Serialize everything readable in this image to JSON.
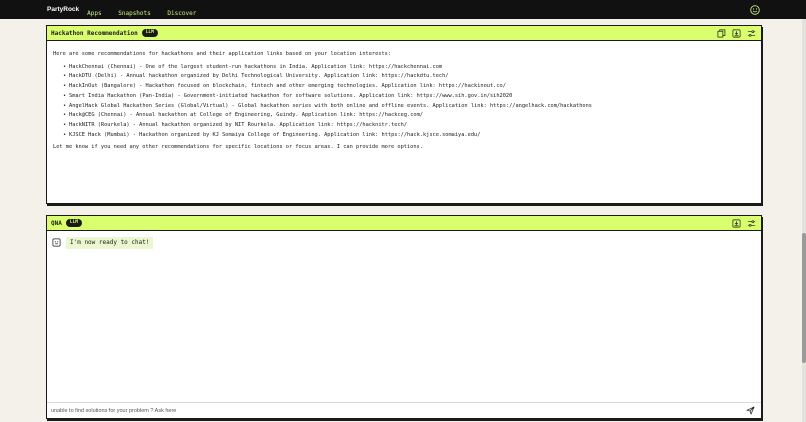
{
  "topbar": {
    "brand": "PartyRock",
    "nav": [
      "Apps",
      "Snapshots",
      "Discover"
    ],
    "profile_icon": "smiley-icon"
  },
  "colors": {
    "accent": "#d9ff6e",
    "topbar_bg": "#111111",
    "nav_link": "#c7f284",
    "page_bg": "#f3f1ea"
  },
  "panel1": {
    "title": "Hackathon Recommendation",
    "badge": "LLM",
    "icons": [
      "copy-icon",
      "save-icon",
      "settings-sliders-icon"
    ],
    "intro": "Here are some recommendations for hackathons and their application links based on your location interests:",
    "items": [
      "HackChennai (Chennai) - One of the largest student-run hackathons in India. Application link: https://hackchennai.com",
      "HackDTU (Delhi) - Annual hackathon organized by Delhi Technological University. Application link: https://hackdtu.tech/",
      "HackInOut (Bangalore) - Hackathon focused on blockchain, fintech and other emerging technologies. Application link: https://hackinout.co/",
      "Smart India Hackathon (Pan-India) - Government-initiated hackathon for software solutions. Application link: https://www.sih.gov.in/sih2020",
      "AngelHack Global Hackathon Series (Global/Virtual) - Global hackathon series with both online and offline events. Application link: https://angelhack.com/hackathons",
      "Hack@CEG (Chennai) - Annual hackathon at College of Engineering, Guindy. Application link: https://hackceg.com/",
      "HackNITR (Rourkela) - Annual hackathon organized by NIT Rourkela. Application link: https://hacknitr.tech/",
      "KJSCE Hack (Mumbai) - Hackathon organized by KJ Somaiya College of Engineering. Application link: https://hack.kjsce.somaiya.edu/"
    ],
    "outro": "Let me know if you need any other recommendations for specific locations or focus areas. I can provide more options."
  },
  "panel2": {
    "title": "QNA",
    "badge": "LLM",
    "icons": [
      "save-icon",
      "settings-sliders-icon"
    ],
    "message": "I'm now ready to chat!",
    "input_placeholder": "unable to find solutions for your problem ? Ask here",
    "send_icon": "send-icon"
  }
}
